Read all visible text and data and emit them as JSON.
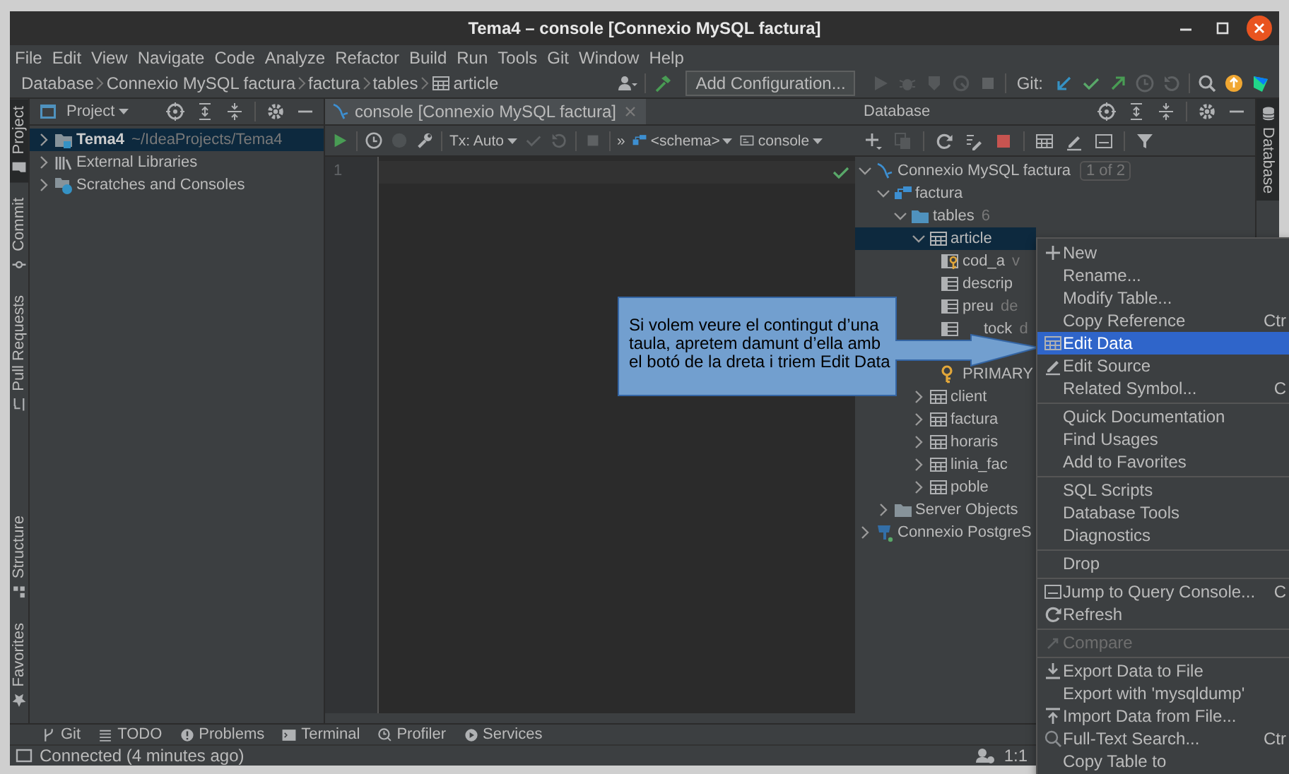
{
  "window": {
    "title": "Tema4 – console [Connexio MySQL factura]"
  },
  "menu_bar": [
    "File",
    "Edit",
    "View",
    "Navigate",
    "Code",
    "Analyze",
    "Refactor",
    "Build",
    "Run",
    "Tools",
    "Git",
    "Window",
    "Help"
  ],
  "breadcrumb": [
    "Database",
    "Connexio MySQL factura",
    "factura",
    "tables",
    "article"
  ],
  "run_toolbar": {
    "configuration": "Add Configuration...",
    "git_label": "Git:"
  },
  "left_stripe": {
    "top": [
      {
        "label": "Project",
        "selected": true
      },
      {
        "label": "Commit",
        "selected": false
      },
      {
        "label": "Pull Requests",
        "selected": false
      }
    ],
    "bottom": [
      {
        "label": "Structure",
        "selected": false
      },
      {
        "label": "Favorites",
        "selected": false
      }
    ]
  },
  "right_stripe": [
    {
      "label": "Database",
      "selected": true
    }
  ],
  "project_panel": {
    "title": "Project",
    "tree": [
      {
        "label": "Tema4",
        "path": "~/IdeaProjects/Tema4",
        "expanded": false,
        "selected": true
      },
      {
        "label": "External Libraries",
        "expanded": false,
        "selected": false
      },
      {
        "label": "Scratches and Consoles",
        "expanded": false,
        "selected": false
      }
    ]
  },
  "editor": {
    "tab": {
      "label": "console [Connexio MySQL factura]",
      "selected": true
    },
    "toolbar": {
      "transaction": "Tx: Auto",
      "overflow": "»",
      "schema": "<schema>",
      "session": "console"
    },
    "line_numbers": [
      "1"
    ]
  },
  "database_panel": {
    "title": "Database",
    "tree": [
      {
        "label": "Connexio MySQL factura",
        "kind": "connection",
        "badge": "1 of 2",
        "expanded": true,
        "selected": false,
        "children": [
          {
            "label": "factura",
            "kind": "schema",
            "expanded": true,
            "selected": false,
            "children": [
              {
                "label": "tables",
                "kind": "table-folder",
                "count": "6",
                "expanded": true,
                "selected": false,
                "children": [
                  {
                    "label": "article",
                    "kind": "table",
                    "expanded": true,
                    "selected": true,
                    "children": [
                      {
                        "label": "cod_a",
                        "kind": "key-column",
                        "detail": "v",
                        "selected": false
                      },
                      {
                        "label": "descrip",
                        "kind": "column",
                        "selected": false
                      },
                      {
                        "label": "preu",
                        "kind": "column",
                        "detail": "de",
                        "selected": false
                      },
                      {
                        "label": "tock",
                        "kind": "partial-column",
                        "detail": "d",
                        "selected": false
                      },
                      {
                        "kind": "covered"
                      },
                      {
                        "label": "PRIMARY",
                        "kind": "key",
                        "selected": false
                      }
                    ]
                  },
                  {
                    "label": "client",
                    "kind": "table",
                    "expanded": false,
                    "selected": false
                  },
                  {
                    "label": "factura",
                    "kind": "table",
                    "expanded": false,
                    "selected": false
                  },
                  {
                    "label": "horaris",
                    "kind": "table",
                    "expanded": false,
                    "selected": false
                  },
                  {
                    "label": "linia_fac",
                    "kind": "table",
                    "expanded": false,
                    "selected": false
                  },
                  {
                    "label": "poble",
                    "kind": "table",
                    "expanded": false,
                    "selected": false
                  }
                ]
              }
            ]
          },
          {
            "label": "Server Objects",
            "kind": "folder",
            "expanded": false,
            "selected": false
          }
        ]
      },
      {
        "label": "Connexio PostgreS",
        "kind": "postgres",
        "expanded": false,
        "selected": false
      }
    ]
  },
  "tool_tabs": [
    "Git",
    "TODO",
    "Problems",
    "Terminal",
    "Profiler",
    "Services"
  ],
  "status_bar": {
    "message": "Connected (4 minutes ago)",
    "position": "1:1"
  },
  "context_menu": {
    "groups": [
      [
        {
          "label": "New",
          "selected": false,
          "disabled": false
        },
        {
          "label": "Rename...",
          "selected": false,
          "disabled": false
        },
        {
          "label": "Modify Table...",
          "selected": false,
          "disabled": false
        },
        {
          "label": "Copy Reference",
          "shortcut": "Ctr",
          "selected": false,
          "disabled": false
        },
        {
          "label": "Edit Data",
          "selected": true,
          "disabled": false
        },
        {
          "label": "Edit Source",
          "selected": false,
          "disabled": false
        },
        {
          "label": "Related Symbol...",
          "shortcut": "C",
          "selected": false,
          "disabled": false
        }
      ],
      [
        {
          "label": "Quick Documentation",
          "selected": false,
          "disabled": false
        },
        {
          "label": "Find Usages",
          "selected": false,
          "disabled": false
        },
        {
          "label": "Add to Favorites",
          "selected": false,
          "disabled": false
        }
      ],
      [
        {
          "label": "SQL Scripts",
          "selected": false,
          "disabled": false
        },
        {
          "label": "Database Tools",
          "selected": false,
          "disabled": false
        },
        {
          "label": "Diagnostics",
          "selected": false,
          "disabled": false
        }
      ],
      [
        {
          "label": "Drop",
          "selected": false,
          "disabled": false
        }
      ],
      [
        {
          "label": "Jump to Query Console...",
          "shortcut": "C",
          "selected": false,
          "disabled": false
        },
        {
          "label": "Refresh",
          "selected": false,
          "disabled": false
        }
      ],
      [
        {
          "label": "Compare",
          "selected": false,
          "disabled": true
        }
      ],
      [
        {
          "label": "Export Data to File",
          "selected": false,
          "disabled": false
        },
        {
          "label": "Export with 'mysqldump'",
          "selected": false,
          "disabled": false
        },
        {
          "label": "Import Data from File...",
          "selected": false,
          "disabled": false
        },
        {
          "label": "Full-Text Search...",
          "shortcut": "Ctr",
          "selected": false,
          "disabled": false
        },
        {
          "label": "Copy Table to",
          "selected": false,
          "disabled": false
        }
      ]
    ]
  },
  "callout": {
    "text": "Si volem veure el contingut d’una taula, apretem damunt d’ella amb el botó de la dreta i triem Edit Data"
  }
}
